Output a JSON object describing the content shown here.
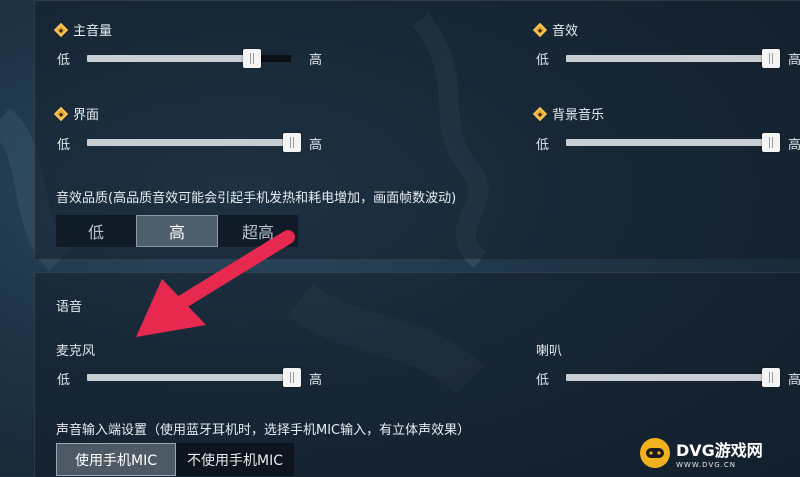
{
  "audio": {
    "master": {
      "label": "主音量",
      "min": "低",
      "max": "高",
      "level": 0.82
    },
    "sfx": {
      "label": "音效",
      "min": "低",
      "max": "高",
      "level": 1.0
    },
    "ui": {
      "label": "界面",
      "min": "低",
      "max": "高",
      "level": 1.0
    },
    "bgm": {
      "label": "背景音乐",
      "min": "低",
      "max": "高",
      "level": 1.0
    }
  },
  "quality": {
    "label": "音效品质(高品质音效可能会引起手机发热和耗电增加，画面帧数波动)",
    "options": [
      "低",
      "高",
      "超高"
    ],
    "selected": "高"
  },
  "voice": {
    "title": "语音",
    "mic": {
      "label": "麦克风",
      "min": "低",
      "max": "高",
      "level": 1.0
    },
    "speaker": {
      "label": "喇叭",
      "min": "低",
      "max": "高",
      "level": 1.0
    },
    "input_label": "声音输入端设置（使用蓝牙耳机时，选择手机MIC输入，有立体声效果）",
    "input_options": [
      "使用手机MIC",
      "不使用手机MIC"
    ],
    "input_selected": "使用手机MIC"
  },
  "watermark": {
    "title": "DVG游戏网",
    "url": "WWW.DVG.CN"
  },
  "colors": {
    "accent_arrow": "#e8294f",
    "icon_orange": "#e8a52a"
  }
}
